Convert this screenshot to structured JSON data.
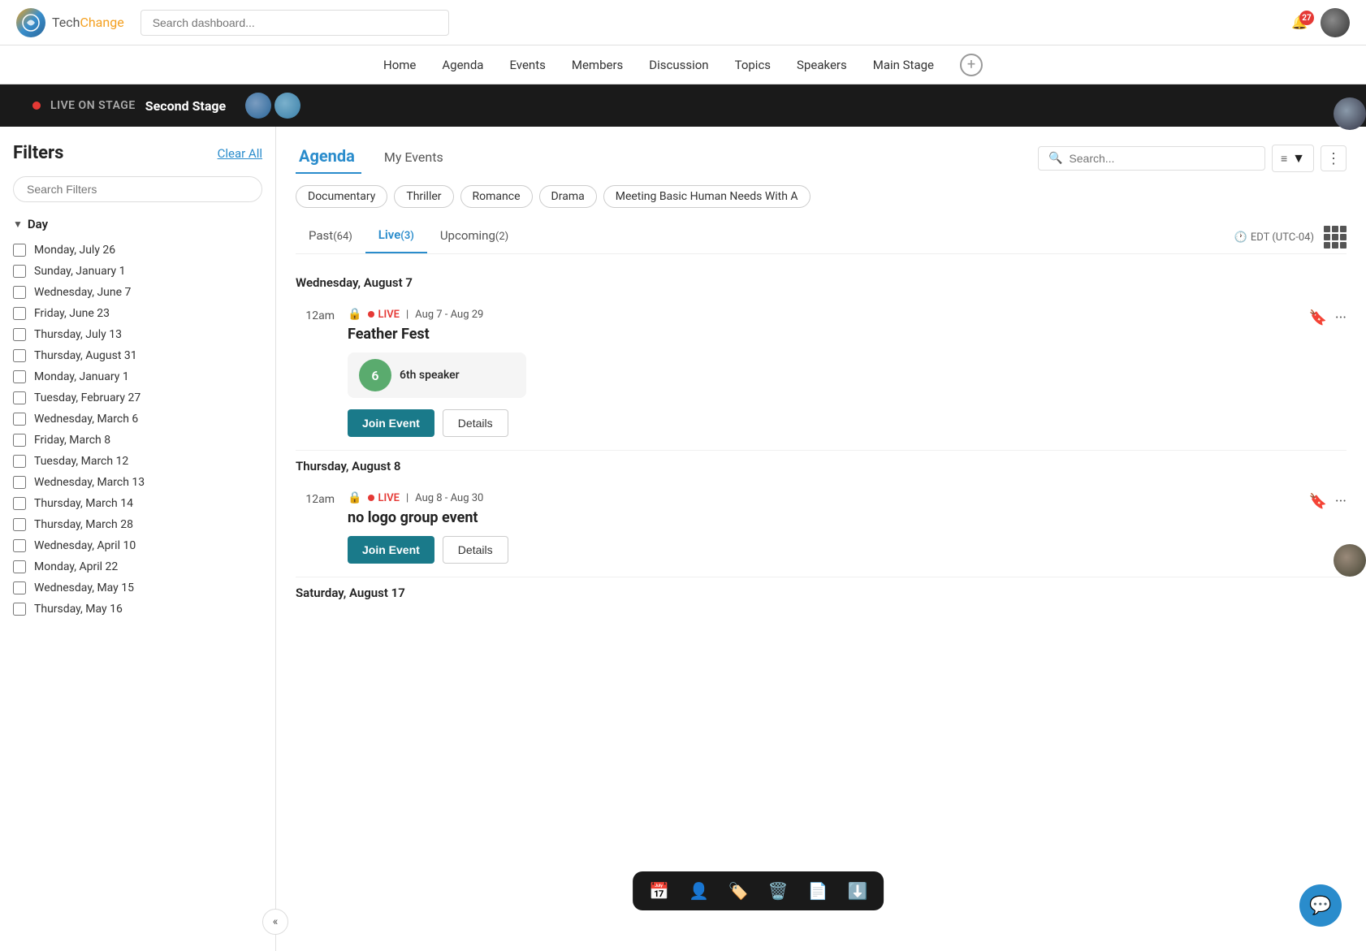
{
  "header": {
    "logo_tech": "Tech",
    "logo_change": "Change",
    "search_placeholder": "Search dashboard...",
    "notification_count": "27",
    "nav_items": [
      "Home",
      "Agenda",
      "Events",
      "Members",
      "Discussion",
      "Topics",
      "Speakers",
      "Main Stage"
    ]
  },
  "live_banner": {
    "live_label": "LIVE ON STAGE",
    "stage_name": "Second Stage"
  },
  "filters": {
    "title": "Filters",
    "clear_all": "Clear All",
    "search_placeholder": "Search Filters",
    "section_day": "Day",
    "days": [
      "Monday, July 26",
      "Sunday, January 1",
      "Wednesday, June 7",
      "Friday, June 23",
      "Thursday, July 13",
      "Thursday, August 31",
      "Monday, January 1",
      "Tuesday, February 27",
      "Wednesday, March 6",
      "Friday, March 8",
      "Tuesday, March 12",
      "Wednesday, March 13",
      "Thursday, March 14",
      "Thursday, March 28",
      "Wednesday, April 10",
      "Monday, April 22",
      "Wednesday, May 15",
      "Thursday, May 16"
    ]
  },
  "agenda": {
    "tab_agenda": "Agenda",
    "tab_my_events": "My Events",
    "search_placeholder": "Search...",
    "tags": [
      "Documentary",
      "Thriller",
      "Romance",
      "Drama",
      "Meeting Basic Human Needs With A"
    ],
    "time_tabs": [
      {
        "label": "Past",
        "count": "64"
      },
      {
        "label": "Live",
        "count": "3"
      },
      {
        "label": "Upcoming",
        "count": "2"
      }
    ],
    "timezone": "EDT (UTC-04)",
    "date_sections": [
      {
        "date": "Wednesday, August 7",
        "events": [
          {
            "time": "12am",
            "live": true,
            "date_range": "Aug 7 - Aug 29",
            "title": "Feather Fest",
            "speaker_num": "6",
            "speaker_label": "6th speaker",
            "join_label": "Join Event",
            "details_label": "Details"
          }
        ]
      },
      {
        "date": "Thursday, August 8",
        "events": [
          {
            "time": "12am",
            "live": true,
            "date_range": "Aug 8 - Aug 30",
            "title": "no logo group event",
            "join_label": "Join Event",
            "details_label": "Details"
          }
        ]
      },
      {
        "date": "Saturday, August 17",
        "events": []
      }
    ]
  },
  "toolbar": {
    "icons": [
      "calendar",
      "person",
      "tag",
      "trash",
      "file",
      "download"
    ]
  },
  "chat": {
    "icon": "💬"
  }
}
